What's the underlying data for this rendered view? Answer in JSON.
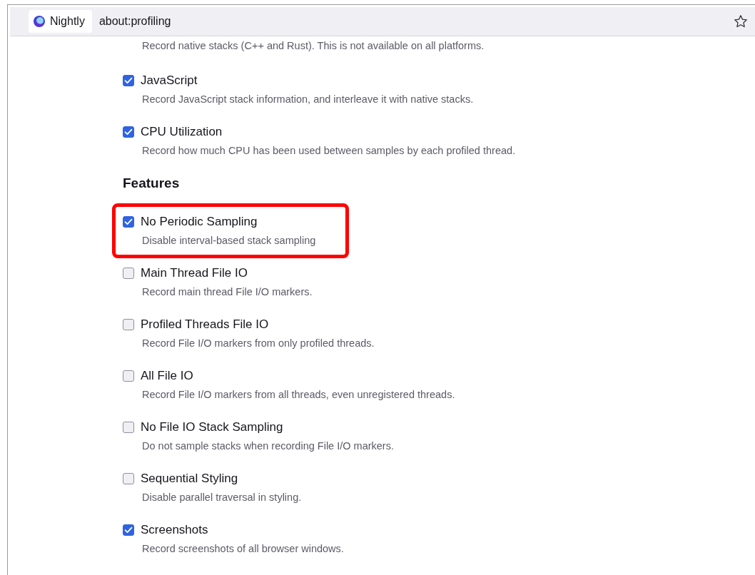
{
  "toolbar": {
    "identity_label": "Nightly",
    "url": "about:profiling"
  },
  "top_sections": [
    {
      "kind": "partial",
      "description": "Record native stacks (C++ and Rust). This is not available on all platforms."
    },
    {
      "kind": "option",
      "label": "JavaScript",
      "description": "Record JavaScript stack information, and interleave it with native stacks.",
      "checked": true,
      "highlighted": false
    },
    {
      "kind": "option",
      "label": "CPU Utilization",
      "description": "Record how much CPU has been used between samples by each profiled thread.",
      "checked": true,
      "highlighted": false
    }
  ],
  "features": {
    "heading": "Features",
    "options": [
      {
        "label": "No Periodic Sampling",
        "description": "Disable interval-based stack sampling",
        "checked": true,
        "highlighted": true
      },
      {
        "label": "Main Thread File IO",
        "description": "Record main thread File I/O markers.",
        "checked": false,
        "highlighted": false
      },
      {
        "label": "Profiled Threads File IO",
        "description": "Record File I/O markers from only profiled threads.",
        "checked": false,
        "highlighted": false
      },
      {
        "label": "All File IO",
        "description": "Record File I/O markers from all threads, even unregistered threads.",
        "checked": false,
        "highlighted": false
      },
      {
        "label": "No File IO Stack Sampling",
        "description": "Do not sample stacks when recording File I/O markers.",
        "checked": false,
        "highlighted": false
      },
      {
        "label": "Sequential Styling",
        "description": "Disable parallel traversal in styling.",
        "checked": false,
        "highlighted": false
      },
      {
        "label": "Screenshots",
        "description": "Record screenshots of all browser windows.",
        "checked": true,
        "highlighted": false
      }
    ]
  }
}
